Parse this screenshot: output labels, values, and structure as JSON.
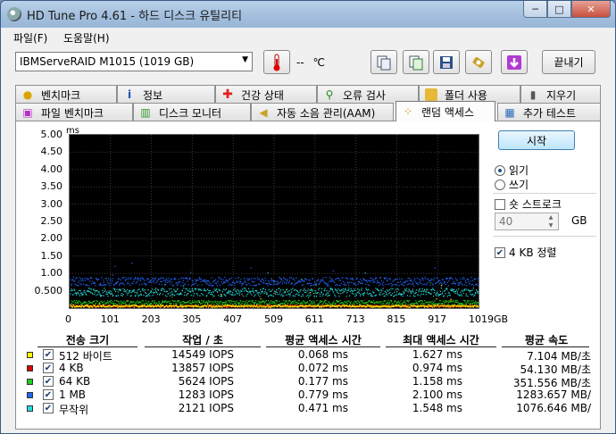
{
  "window": {
    "title": "HD Tune Pro 4.61 - 하드 디스크 유틸리티",
    "controls": [
      "─",
      "□",
      "✕"
    ]
  },
  "menu": {
    "items": [
      "파일(F)",
      "도움말(H)"
    ]
  },
  "toolbar": {
    "drive": "IBMServeRAID M1015 (1019 GB)",
    "temperature": "--",
    "temp_unit": "℃",
    "exit_label": "끝내기"
  },
  "tabs_top": [
    {
      "label": "벤치마크",
      "icon": "benchmark-icon"
    },
    {
      "label": "정보",
      "icon": "info-icon"
    },
    {
      "label": "건강 상태",
      "icon": "health-icon"
    },
    {
      "label": "오류 검사",
      "icon": "error-scan-icon"
    },
    {
      "label": "폴더 사용",
      "icon": "folder-icon"
    },
    {
      "label": "지우기",
      "icon": "trash-icon"
    }
  ],
  "tabs_bottom": [
    {
      "label": "파일 벤치마크",
      "icon": "file-benchmark-icon"
    },
    {
      "label": "디스크 모니터",
      "icon": "disk-monitor-icon"
    },
    {
      "label": "자동 소음 관리(AAM)",
      "icon": "speaker-icon"
    },
    {
      "label": "랜덤 액세스",
      "icon": "random-access-icon",
      "active": true
    },
    {
      "label": "추가 테스트",
      "icon": "extra-tests-icon"
    }
  ],
  "side": {
    "start_label": "시작",
    "read_label": "읽기",
    "write_label": "쓰기",
    "short_stroke_label": "숏 스트로크",
    "short_stroke_value": "40",
    "gb_label": "GB",
    "align_label": "4 KB 정렬",
    "read_selected": true,
    "align_checked": true
  },
  "chart_data": {
    "type": "scatter",
    "ylabel": "ms",
    "y_ticks": [
      "5.00",
      "4.50",
      "4.00",
      "3.50",
      "3.00",
      "2.50",
      "2.00",
      "1.50",
      "1.00",
      "0.500"
    ],
    "x_ticks": [
      "0",
      "101",
      "203",
      "305",
      "407",
      "509",
      "611",
      "713",
      "815",
      "917",
      "1019GB"
    ],
    "xlim": [
      0,
      1019
    ],
    "ylim": [
      0,
      5.0
    ],
    "grid": true,
    "series": [
      {
        "name": "512 바이트",
        "color": "#ffff00",
        "avg_ms": 0.068
      },
      {
        "name": "4 KB",
        "color": "#ff0000",
        "avg_ms": 0.072
      },
      {
        "name": "64 KB",
        "color": "#22cc22",
        "avg_ms": 0.177
      },
      {
        "name": "1 MB",
        "color": "#2266ff",
        "avg_ms": 0.779
      },
      {
        "name": "무작위",
        "color": "#22dddd",
        "avg_ms": 0.471
      }
    ]
  },
  "results": {
    "headers": [
      "전송 크기",
      "작업 / 초",
      "평균 액세스 시간",
      "최대 액세스 시간",
      "평균 속도"
    ],
    "rows": [
      {
        "size": "512 바이트",
        "iops": "14549 IOPS",
        "avg": "0.068 ms",
        "max": "1.627 ms",
        "speed": "7.104 MB/초",
        "color": "#ffff00"
      },
      {
        "size": "4 KB",
        "iops": "13857 IOPS",
        "avg": "0.072 ms",
        "max": "0.974 ms",
        "speed": "54.130 MB/초",
        "color": "#dd0000"
      },
      {
        "size": "64 KB",
        "iops": "5624 IOPS",
        "avg": "0.177 ms",
        "max": "1.158 ms",
        "speed": "351.556 MB/초",
        "color": "#22cc22"
      },
      {
        "size": "1 MB",
        "iops": "1283 IOPS",
        "avg": "0.779 ms",
        "max": "2.100 ms",
        "speed": "1283.657 MB/",
        "color": "#2266ee"
      },
      {
        "size": "무작위",
        "iops": "2121 IOPS",
        "avg": "0.471 ms",
        "max": "1.548 ms",
        "speed": "1076.646 MB/",
        "color": "#22dddd"
      }
    ]
  }
}
